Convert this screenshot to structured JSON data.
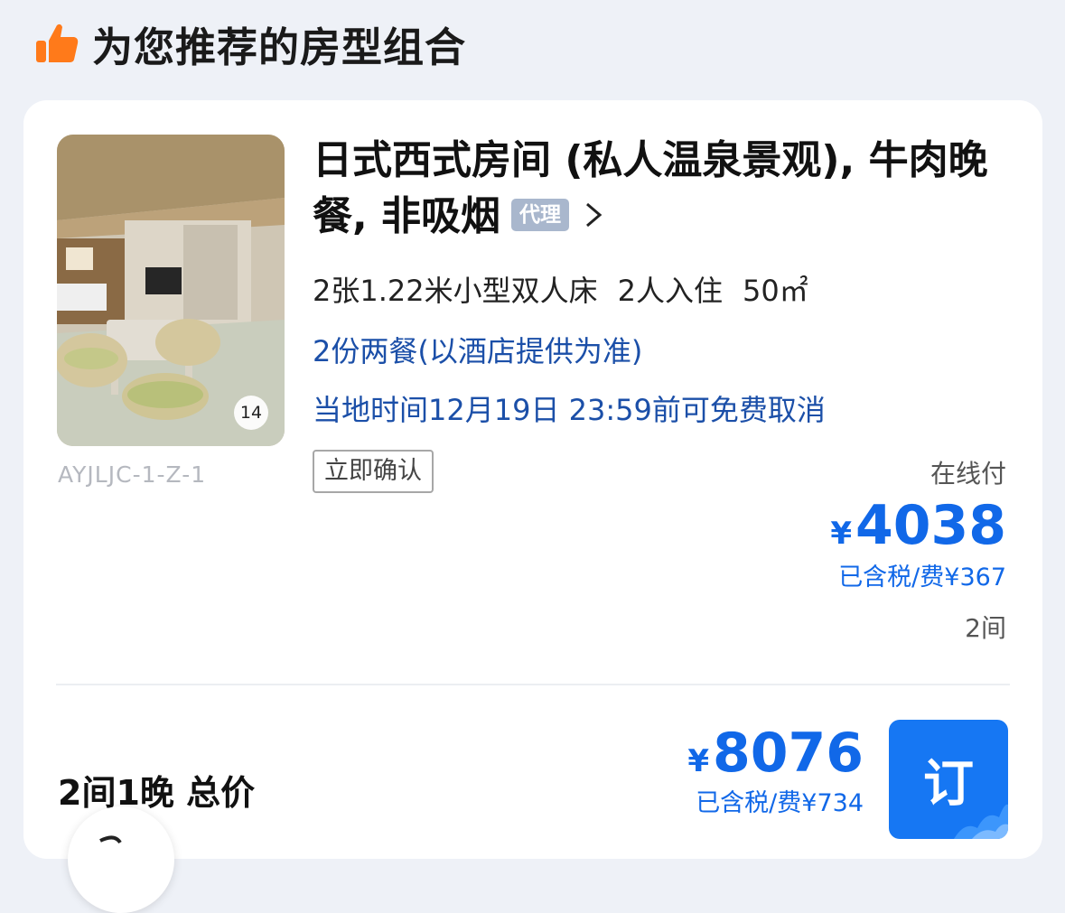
{
  "section": {
    "title": "为您推荐的房型组合",
    "icon": "thumbs-up-icon",
    "icon_color": "#ff7a1a"
  },
  "room": {
    "name": "日式西式房间 (私人温泉景观), 牛肉晚餐, 非吸烟",
    "agent_badge": "代理",
    "photo_count": "14",
    "code": "AYJLJC-1-Z-1",
    "bed": "2张1.22米小型双人床",
    "occupancy": "2人入住",
    "area": "50㎡",
    "meal": "2份两餐(以酒店提供为准)",
    "cancellation": "当地时间12月19日 23:59前可免费取消",
    "confirm_tag": "立即确认",
    "payment_type": "在线付",
    "currency": "¥",
    "price": "4038",
    "tax_note": "已含税/费¥367",
    "rooms": "2间"
  },
  "total": {
    "label": "2间1晚 总价",
    "currency": "¥",
    "price": "8076",
    "tax_note": "已含税/费¥734",
    "book_label": "订"
  },
  "colors": {
    "accent_blue": "#1168e8",
    "button_blue": "#1677f3",
    "link_blue": "#1b4fa8",
    "badge_gray_blue": "#a9b7cd",
    "page_background": "#eef1f7"
  }
}
